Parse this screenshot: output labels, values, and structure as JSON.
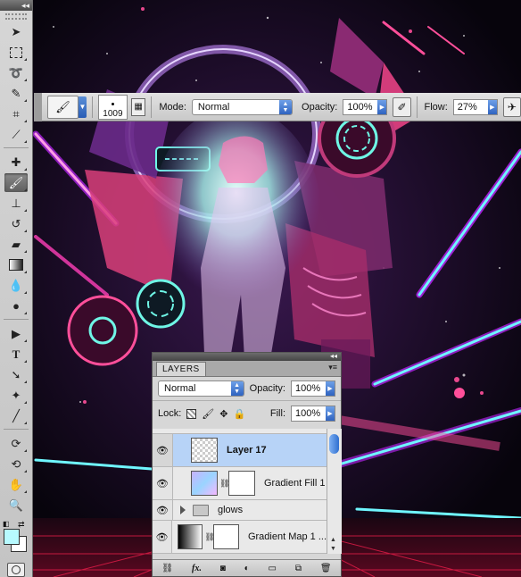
{
  "options_bar": {
    "brush_size": "1009",
    "mode_label": "Mode:",
    "mode_value": "Normal",
    "opacity_label": "Opacity:",
    "opacity_value": "100%",
    "flow_label": "Flow:",
    "flow_value": "27%"
  },
  "tools": [
    "move-tool-icon",
    "marquee-tool-icon",
    "lasso-tool-icon",
    "quick-selection-tool-icon",
    "crop-tool-icon",
    "eyedropper-tool-icon",
    "spot-healing-tool-icon",
    "brush-tool-icon",
    "clone-stamp-tool-icon",
    "history-brush-tool-icon",
    "eraser-tool-icon",
    "gradient-tool-icon",
    "blur-tool-icon",
    "dodge-tool-icon",
    "path-selection-tool-icon",
    "type-tool-icon",
    "pen-tool-icon",
    "custom-shape-tool-icon",
    "line-tool-icon",
    "3d-rotate-tool-icon",
    "3d-orbit-tool-icon",
    "hand-tool-icon",
    "zoom-tool-icon"
  ],
  "colors": {
    "foreground": "#b7faff",
    "background": "#ffffff",
    "selection": "#b7d3f7"
  },
  "layers_panel": {
    "tab_label": "LAYERS",
    "blend_mode": "Normal",
    "opacity_label": "Opacity:",
    "opacity_value": "100%",
    "lock_label": "Lock:",
    "fill_label": "Fill:",
    "fill_value": "100%",
    "layers": [
      {
        "name": "Layer 17",
        "selected": true
      },
      {
        "name": "Gradient Fill 1",
        "selected": false
      },
      {
        "name": "glows",
        "selected": false
      },
      {
        "name": "Gradient Map 1 ...",
        "selected": false
      }
    ]
  }
}
